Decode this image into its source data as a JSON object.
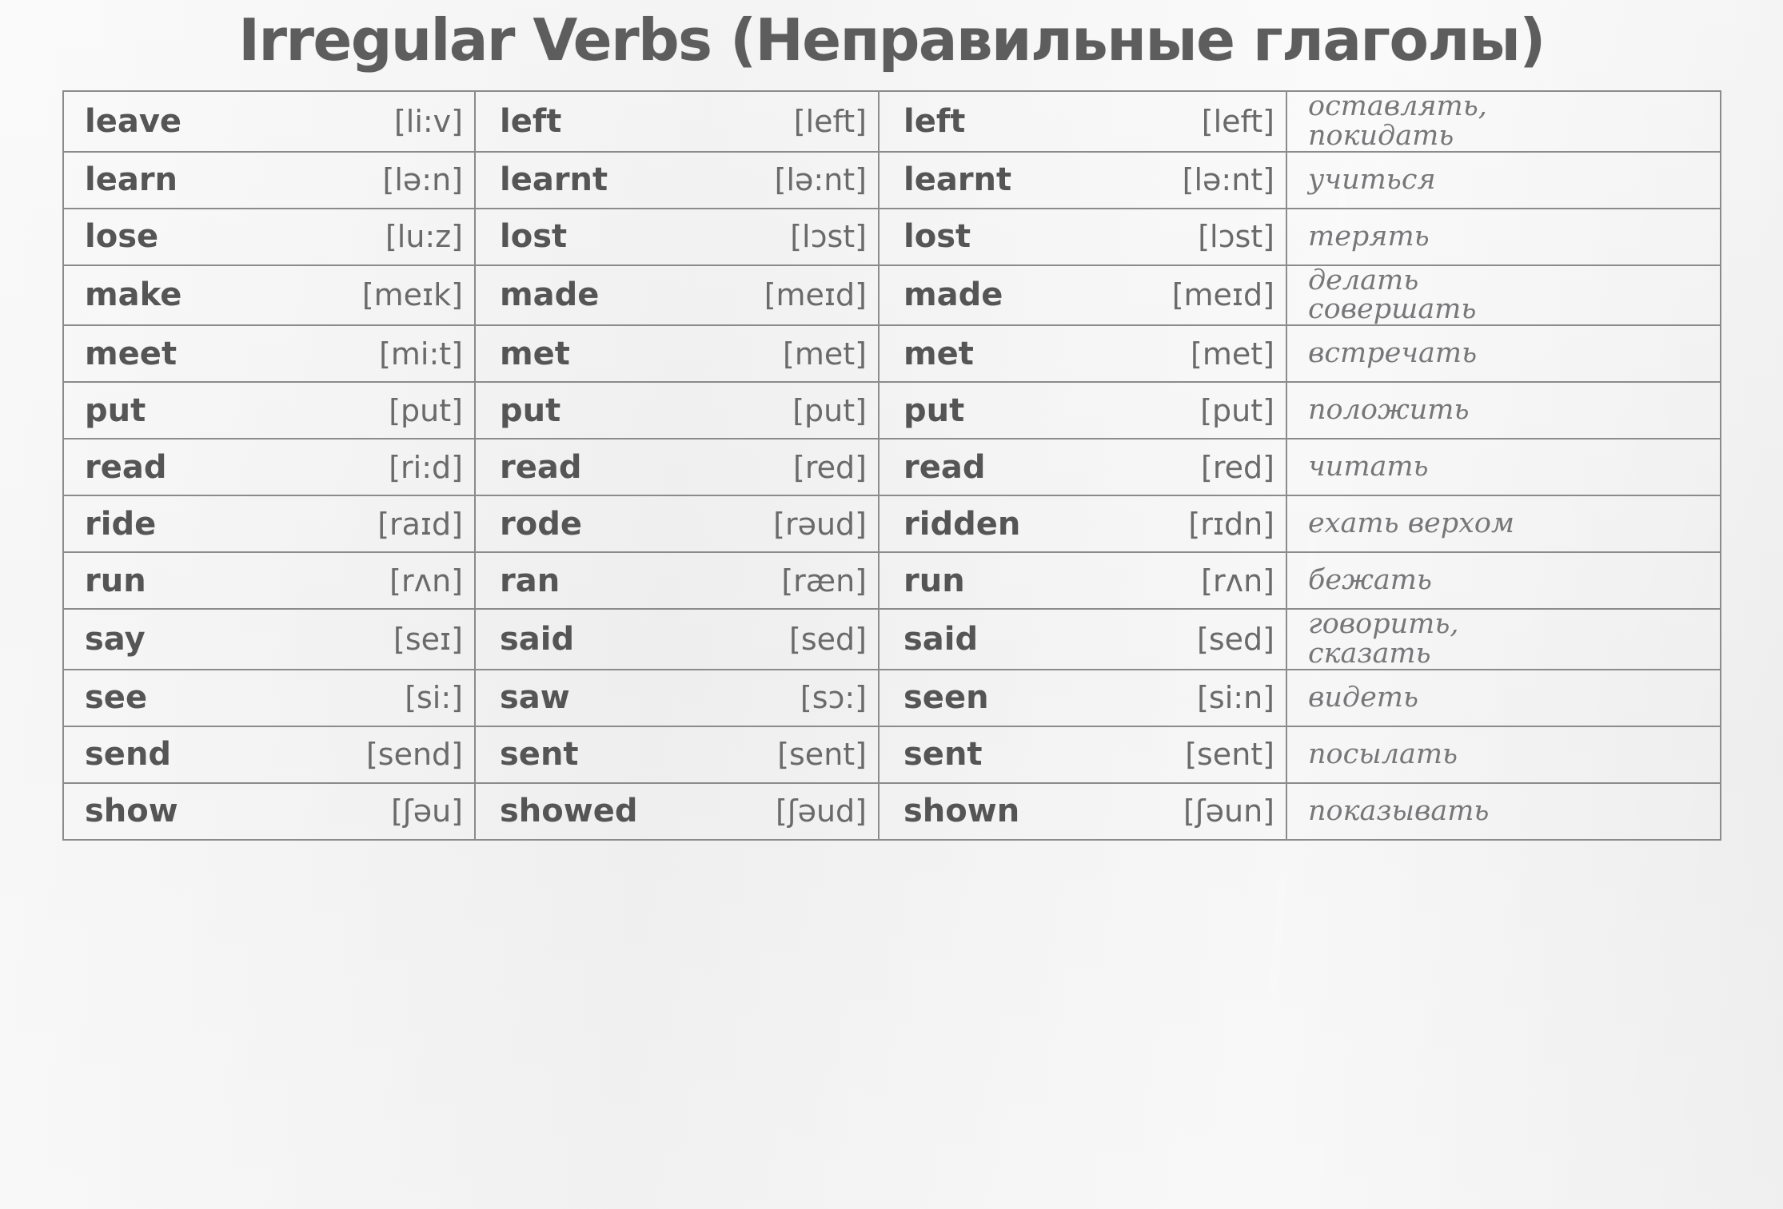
{
  "document": {
    "title": "Irregular Verbs (Неправильные глаголы)",
    "accent_color": "#5d5d5d",
    "border_color": "#8b8b8b",
    "background_color": "#f1f1f1"
  },
  "table": {
    "column_groups": [
      "infinitive",
      "past_simple",
      "past_participle",
      "translation"
    ],
    "rows": [
      {
        "base": "leave",
        "base_tr": "[li:v]",
        "past": "left",
        "past_tr": "[left]",
        "pp": "left",
        "pp_tr": "[left]",
        "ru": "оставлять,\nпокидать"
      },
      {
        "base": "learn",
        "base_tr": "[lə:n]",
        "past": "learnt",
        "past_tr": "[lə:nt]",
        "pp": "learnt",
        "pp_tr": "[lə:nt]",
        "ru": "учиться"
      },
      {
        "base": "lose",
        "base_tr": "[lu:z]",
        "past": "lost",
        "past_tr": "[lɔst]",
        "pp": "lost",
        "pp_tr": "[lɔst]",
        "ru": "терять"
      },
      {
        "base": "make",
        "base_tr": "[meɪk]",
        "past": "made",
        "past_tr": "[meɪd]",
        "pp": "made",
        "pp_tr": "[meɪd]",
        "ru": "делать\nсовершать"
      },
      {
        "base": "meet",
        "base_tr": "[mi:t]",
        "past": "met",
        "past_tr": "[met]",
        "pp": "met",
        "pp_tr": "[met]",
        "ru": "встречать"
      },
      {
        "base": "put",
        "base_tr": "[put]",
        "past": "put",
        "past_tr": "[put]",
        "pp": "put",
        "pp_tr": "[put]",
        "ru": "положить"
      },
      {
        "base": "read",
        "base_tr": "[ri:d]",
        "past": "read",
        "past_tr": "[red]",
        "pp": "read",
        "pp_tr": "[red]",
        "ru": "читать"
      },
      {
        "base": "ride",
        "base_tr": "[raɪd]",
        "past": "rode",
        "past_tr": "[rəud]",
        "pp": "ridden",
        "pp_tr": "[rɪdn]",
        "ru": "ехать верхом"
      },
      {
        "base": "run",
        "base_tr": "[rʌn]",
        "past": "ran",
        "past_tr": "[ræn]",
        "pp": "run",
        "pp_tr": "[rʌn]",
        "ru": "бежать"
      },
      {
        "base": "say",
        "base_tr": "[seɪ]",
        "past": "said",
        "past_tr": "[sed]",
        "pp": "said",
        "pp_tr": "[sed]",
        "ru": "говорить,\nсказать"
      },
      {
        "base": "see",
        "base_tr": "[si:]",
        "past": "saw",
        "past_tr": "[sɔ:]",
        "pp": "seen",
        "pp_tr": "[si:n]",
        "ru": "видеть"
      },
      {
        "base": "send",
        "base_tr": "[send]",
        "past": "sent",
        "past_tr": "[sent]",
        "pp": "sent",
        "pp_tr": "[sent]",
        "ru": "посылать"
      },
      {
        "base": "show",
        "base_tr": "[ʃəu]",
        "past": "showed",
        "past_tr": "[ʃəud]",
        "pp": "shown",
        "pp_tr": "[ʃəun]",
        "ru": "показывать"
      }
    ]
  }
}
